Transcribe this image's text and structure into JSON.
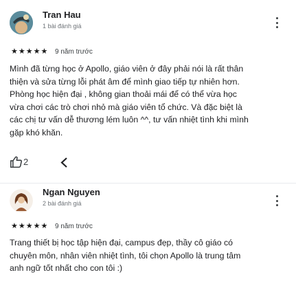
{
  "reviews": [
    {
      "author": "Tran Hau",
      "review_count": "1 bài đánh giá",
      "rating": 5,
      "date": "9 năm trước",
      "text_lines": [
        "Mình đã từng học ở Apollo, giáo viên ở đây phải nói là rất thân",
        "thiện và sửa từng lỗi phát âm để mình giao tiếp tự nhiên hơn.",
        "Phòng học hiện đại , không gian thoải mái để có thể vừa học",
        "vừa chơi các trò chơi nhỏ mà giáo viên tổ chức. Và đặc biệt là",
        "các chị tư vấn dễ thương lém luôn ^^, tư vấn nhiệt tình khi mình",
        "gặp khó khăn."
      ],
      "likes": "2",
      "avatar_color": "#3b6e7a"
    },
    {
      "author": "Ngan Nguyen",
      "review_count": "2 bài đánh giá",
      "rating": 5,
      "date": "9 năm trước",
      "text_lines": [
        "Trang thiết bị học tập hiện đại, campus đẹp, thầy cô giáo có",
        "chuyên môn, nhân viên nhiệt tình, tôi chọn Apollo là trung tâm",
        "anh ngữ tốt nhất cho con tôi :)"
      ],
      "avatar_color": "#7a4a2e"
    }
  ],
  "icons": {
    "more": "more-vert-icon",
    "star": "star-icon",
    "like": "thumb-up-icon",
    "share": "share-icon"
  }
}
